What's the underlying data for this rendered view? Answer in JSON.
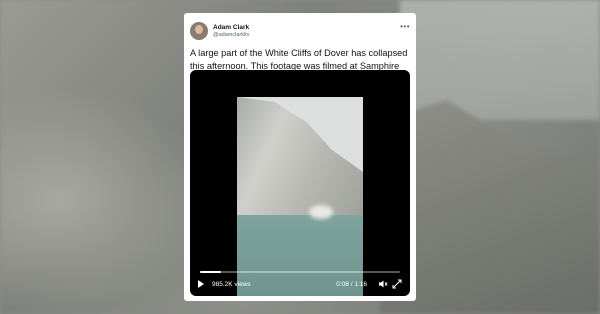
{
  "tweet": {
    "author_name": "Adam Clark",
    "author_handle": "@adamclarkitv",
    "text": "A large part of the White Cliffs of Dover has collapsed this afternoon. This footage was filmed at Samphire Ho.",
    "more_icon": "more-dots-icon"
  },
  "video": {
    "views": "985.2K views",
    "time": "0:08 / 1:16",
    "progress": 0.105,
    "icons": [
      "play-icon",
      "mute-icon",
      "fullscreen-icon"
    ]
  }
}
